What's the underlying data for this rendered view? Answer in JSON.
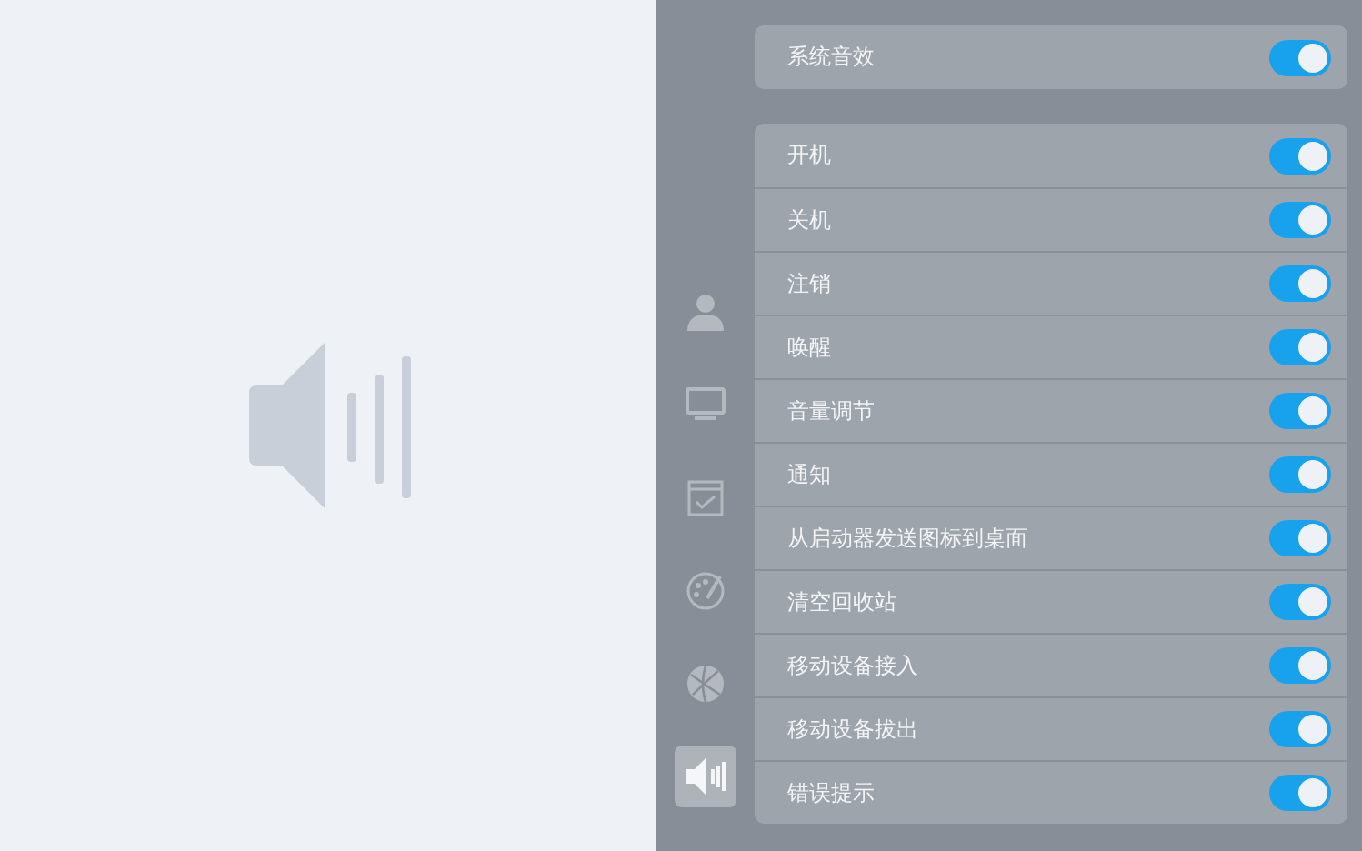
{
  "nav": [
    {
      "kind": "user",
      "selected": false
    },
    {
      "kind": "display",
      "selected": false
    },
    {
      "kind": "calendar",
      "selected": false
    },
    {
      "kind": "palette",
      "selected": false
    },
    {
      "kind": "globe",
      "selected": false
    },
    {
      "kind": "sound",
      "selected": true
    }
  ],
  "master": {
    "label": "系统音效",
    "on": true
  },
  "effects": [
    {
      "label": "开机",
      "on": true
    },
    {
      "label": "关机",
      "on": true
    },
    {
      "label": "注销",
      "on": true
    },
    {
      "label": "唤醒",
      "on": true
    },
    {
      "label": "音量调节",
      "on": true
    },
    {
      "label": "通知",
      "on": true
    },
    {
      "label": "从启动器发送图标到桌面",
      "on": true
    },
    {
      "label": "清空回收站",
      "on": true
    },
    {
      "label": "移动设备接入",
      "on": true
    },
    {
      "label": "移动设备拔出",
      "on": true
    },
    {
      "label": "错误提示",
      "on": true
    }
  ]
}
